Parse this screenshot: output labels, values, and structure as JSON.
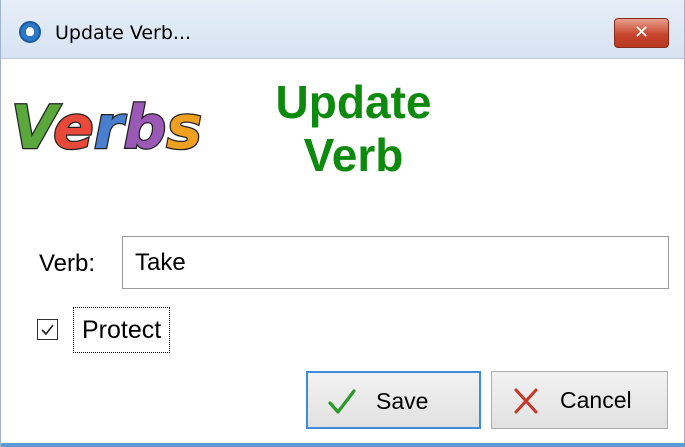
{
  "window": {
    "title": "Update Verb...",
    "close_symbol": "✕"
  },
  "logo": {
    "text": "Verbs",
    "letter_colors": [
      "#5aa83c",
      "#e8493a",
      "#4a7fd0",
      "#9b59b6",
      "#f0a020"
    ]
  },
  "heading": {
    "line1": "Update",
    "line2": "Verb",
    "color": "#0d8a0d"
  },
  "form": {
    "verb_label": "Verb:",
    "verb_value": "Take",
    "protect_label": "Protect",
    "protect_checked": true
  },
  "buttons": {
    "save_label": "Save",
    "cancel_label": "Cancel"
  },
  "icons": {
    "app": "app-icon",
    "close": "close-icon",
    "check": "checkmark-icon",
    "save": "green-check-icon",
    "cancel": "red-x-icon"
  }
}
